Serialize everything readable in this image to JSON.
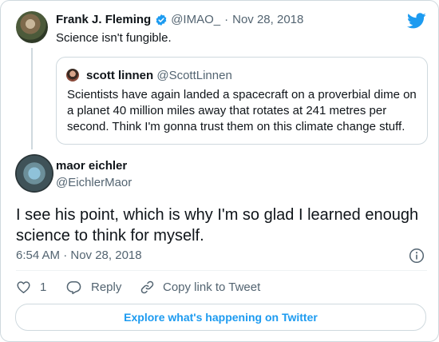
{
  "colors": {
    "accent": "#1d9bf0",
    "text": "#0f1419",
    "muted": "#536471",
    "border": "#cfd9de"
  },
  "icons": {
    "logo": "twitter-bird-icon",
    "verified": "verified-badge-icon",
    "info": "info-icon",
    "like": "heart-icon",
    "reply": "reply-bubble-icon",
    "copy_link": "link-icon"
  },
  "parent_tweet": {
    "name": "Frank J. Fleming",
    "handle": "@IMAO_",
    "separator": "·",
    "date": "Nov 28, 2018",
    "text": "Science isn't fungible.",
    "quoted": {
      "name": "scott linnen",
      "handle": "@ScottLinnen",
      "text": "Scientists have again landed a spacecraft on a proverbial dime on a planet 40 million miles away that rotates at 241 metres per second. Think I'm gonna trust them on this climate change stuff."
    }
  },
  "main_tweet": {
    "name": "maor eichler",
    "handle": "@EichlerMaor",
    "text": "I see his point, which is why I'm so glad I learned enough science to think for myself.",
    "timestamp": "6:54 AM · Nov 28, 2018"
  },
  "actions": {
    "like_count": "1",
    "reply_label": "Reply",
    "copy_link_label": "Copy link to Tweet"
  },
  "explore_label": "Explore what's happening on Twitter"
}
